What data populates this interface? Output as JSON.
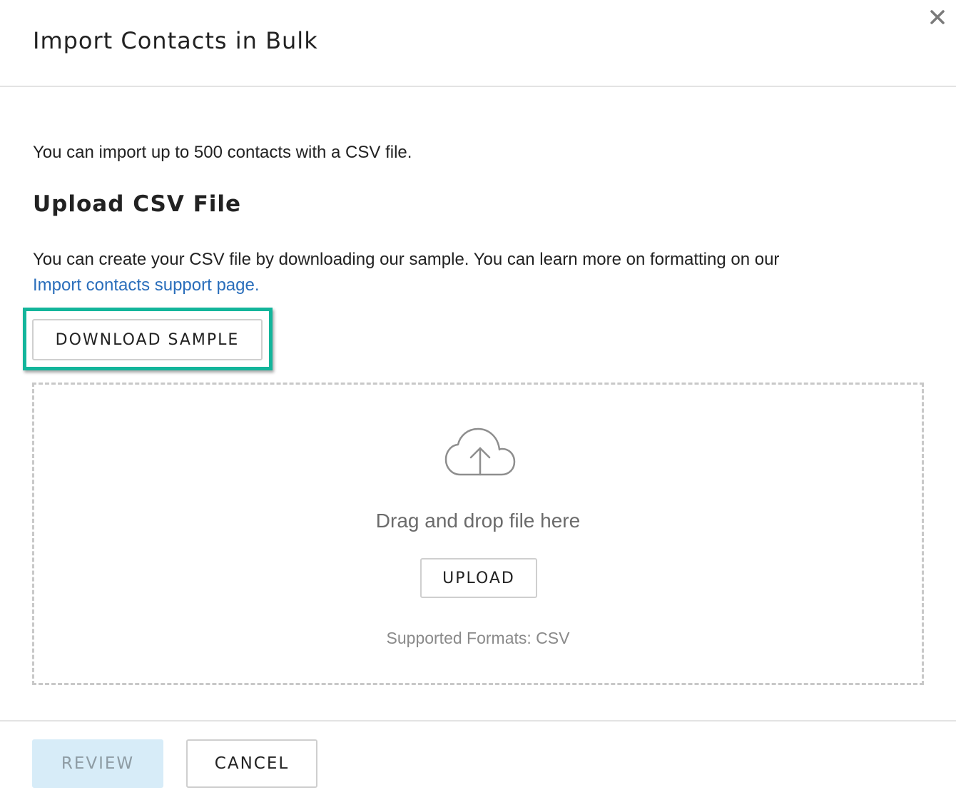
{
  "dialog": {
    "title": "Import Contacts in Bulk",
    "close_icon": "close-icon"
  },
  "body": {
    "intro": "You can import up to 500 contacts with a CSV file.",
    "section_title": "Upload CSV File",
    "description": "You can create your CSV file by downloading our sample. You can learn more on formatting on our",
    "support_link": "Import contacts support page.",
    "download_button": "DOWNLOAD SAMPLE"
  },
  "dropzone": {
    "icon": "cloud-upload-icon",
    "text": "Drag and drop file here",
    "upload_button": "UPLOAD",
    "formats": "Supported Formats: CSV"
  },
  "footer": {
    "review_button": "REVIEW",
    "cancel_button": "CANCEL"
  },
  "colors": {
    "highlight": "#13b59b",
    "link": "#2a6ebb",
    "review_bg": "#d7ecf8",
    "review_text": "#8d9ba3"
  }
}
